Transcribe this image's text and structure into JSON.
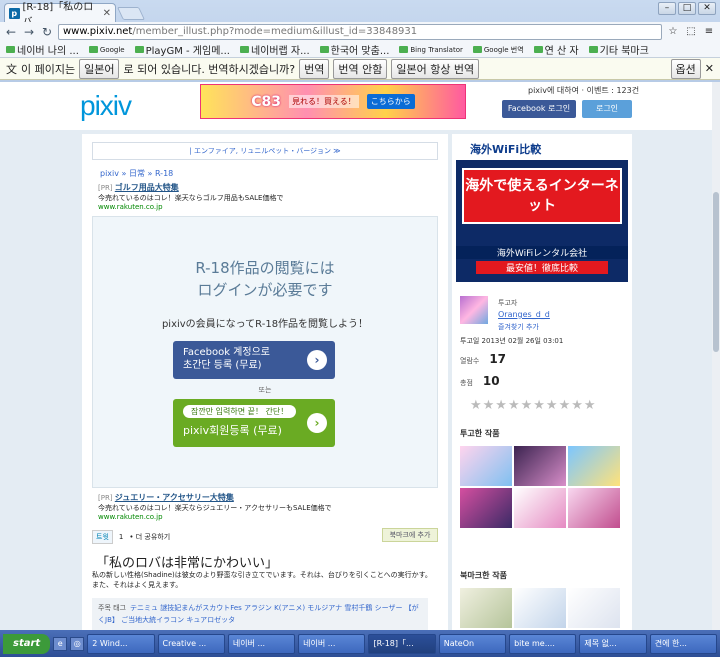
{
  "browser": {
    "tab_title": "[R-18]「私のロバ",
    "tab_favicon": "p",
    "url_host": "www.pixiv.net",
    "url_path": "/member_illust.php?mode=medium&illust_id=33848931",
    "bookmarks": [
      {
        "label": "네이버 나의 ..."
      },
      {
        "label": "Google"
      },
      {
        "label": "PlayGM - 게임메..."
      },
      {
        "label": "네이버랩 자..."
      },
      {
        "label": "한국어 맞춤..."
      },
      {
        "label": "Bing Translator"
      },
      {
        "label": "Google 번역"
      },
      {
        "label": "연 산 자"
      },
      {
        "label": "기타 북마크"
      }
    ]
  },
  "translate_bar": {
    "prefix": "이 페이지는",
    "language": "일본어",
    "middle": "로 되어 있습니다. 번역하시겠습니까?",
    "translate_btn": "번역",
    "no_btn": "번역 안함",
    "always_btn": "일본어 항상 번역",
    "options_btn": "옵션"
  },
  "pixiv_header": {
    "logo": "pixiv",
    "banner_c83": "C83",
    "banner_sub": "見れる！買える！",
    "banner_go": "こちらから",
    "top_links": "pixiv에 대하여 · 이벤트 : 123건",
    "fb_login": "Facebook 로그인",
    "login": "로그인"
  },
  "main": {
    "notice": "| エンファイア, リュニルペット・バージョン ≫",
    "breadcrumb": "pixiv  »  日常  »  R-18",
    "ad1": {
      "pr": "[PR]",
      "title": "ゴルフ用品大特集",
      "desc": "今売れているのはコレ！楽天ならゴルフ用品もSALE価格で",
      "url": "www.rakuten.co.jp"
    },
    "gate_title_1": "R-18作品の閲覧には",
    "gate_title_2": "ログインが必要です",
    "gate_sub": "pixivの会員になってR-18作品を閲覧しよう！",
    "fb_line1": "Facebook 계정으로",
    "fb_line2": "초간단 등록 (무료)",
    "or": "또는",
    "reg_bubble": "잠깐만 입력하면 끝！ 간단！",
    "reg_label": "pixiv회원등록 (무료)",
    "ad2": {
      "pr": "[PR]",
      "title": "ジュエリー・アクセサリー大特集",
      "desc": "今売れているのはコレ！楽天ならジュエリー・アクセサリーもSALE価格で",
      "url": "www.rakuten.co.jp"
    },
    "tweet": "트윗",
    "tweet_count": "1",
    "share": "• 더 공유하기",
    "bookmark_btn": "북마크에 추가",
    "title": "「私のロバは非常にかわいい」",
    "caption": "私の新しい性格(Shadine)は彼女のより野蛮な引き立てでいます。それは、台びりを引くことへの実行かす。 また、それはよく見えます。",
    "tags_label": "주목 태그",
    "tags": "テニミュ  謎技妃まんがスカウトFes  アラジン  K(アニメ)  モルジアナ  雪村千鶴  シーザー  【がくJB】  ご当地大統イラコン  キュアロゼッタ"
  },
  "sidebar": {
    "ad_top": "海外WiFi比較",
    "ad_big": "海外で使えるインターネット",
    "ad_line1": "海外WiFiレンタル会社",
    "ad_line2": "最安値！徹底比較",
    "poster_label": "투고자",
    "poster_name": "Oranges_d_d",
    "fav_user": "즐겨찾기 추가",
    "date": "투고일   2013년 02월 26일 03:01",
    "views_label": "열람수",
    "views": "17",
    "score_label": "총점",
    "score": "10",
    "stars": "★★★★★★★★★★",
    "posted_works": "투고한 작품",
    "bookmarked_works": "북마크한 작품"
  },
  "taskbar": {
    "start": "start",
    "items": [
      "2 Wind...",
      "Creative ...",
      "네이버 ...",
      "네이버 ...",
      "[R-18]「...",
      "NateOn",
      "bite me....",
      "제목 없...",
      "견에 한..."
    ]
  }
}
